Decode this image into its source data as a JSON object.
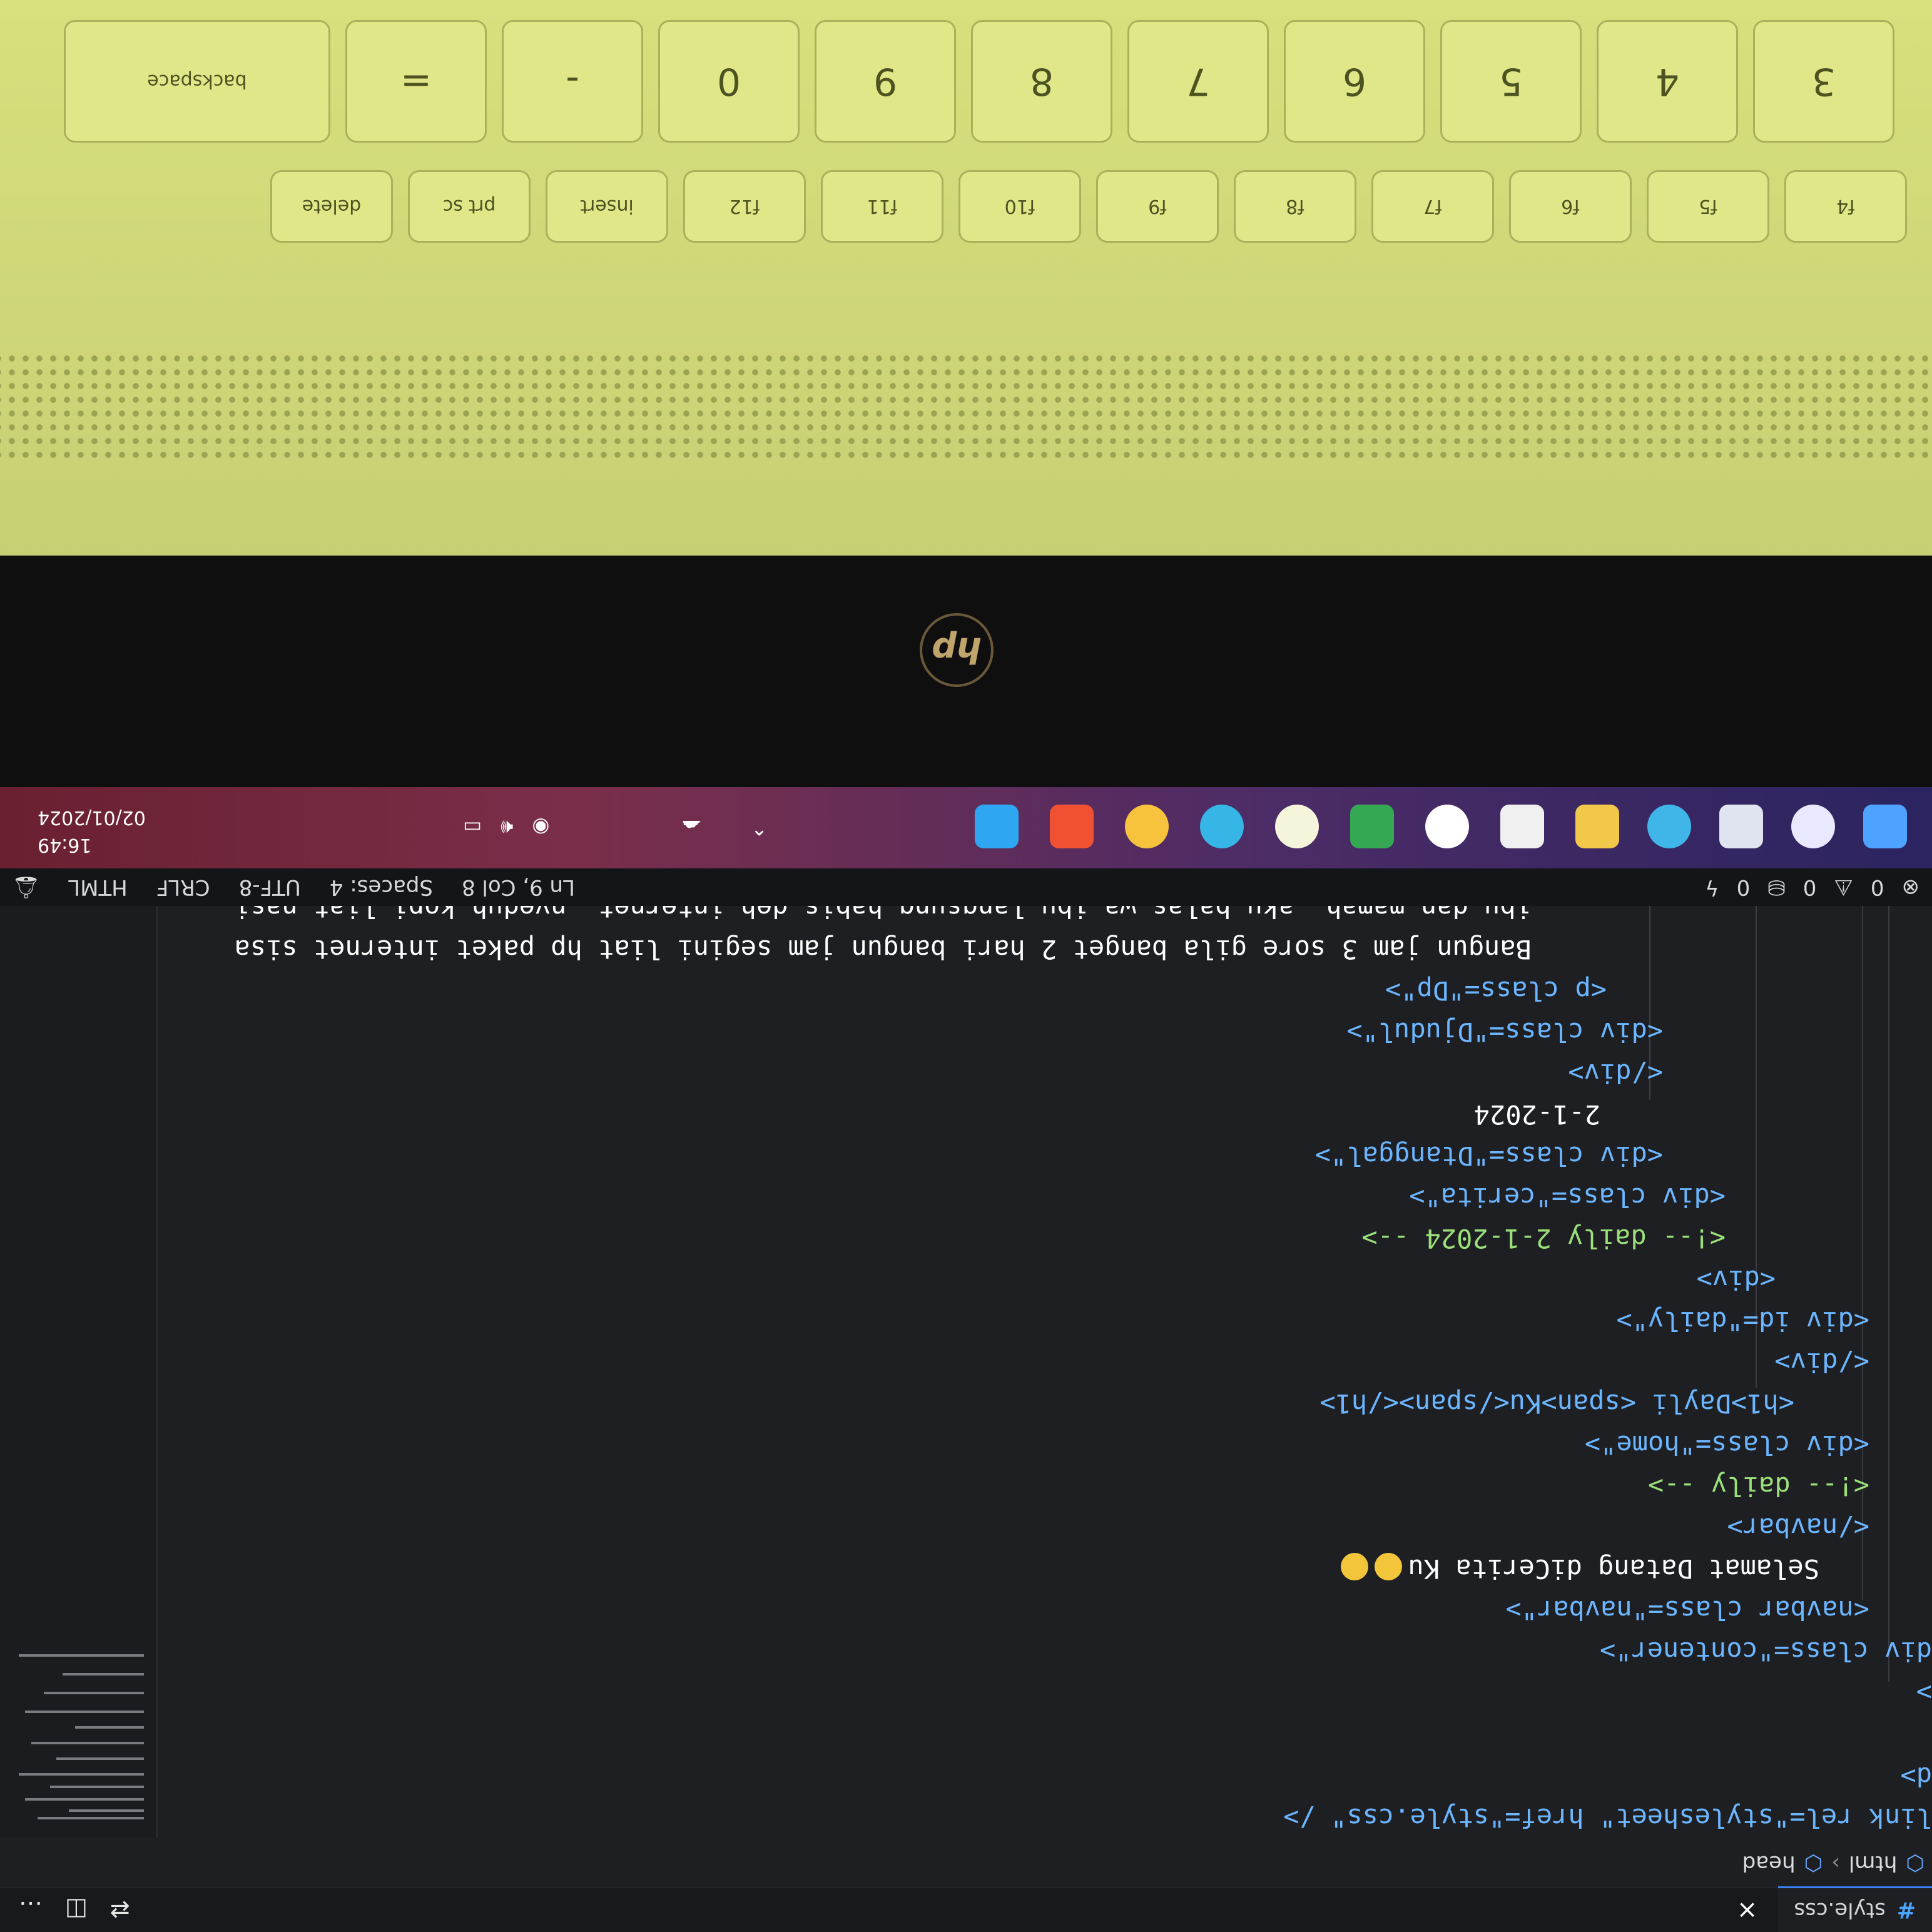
{
  "editor": {
    "tab": {
      "icon": "hash-icon",
      "title": "style.css",
      "close": "×"
    },
    "actions": [
      "⇄",
      "◫",
      "…"
    ],
    "breadcrumb": [
      "html",
      "head"
    ],
    "lines": {
      "l1": "link rel=\"stylesheet\" href=\"style.css\" />",
      "l2": "d>",
      "l3": ">",
      "l4": "div class=\"contener\">",
      "l5": "<navbar class=\"navbar\">",
      "l6": "Selamat Datang diCerita Ku",
      "l7": "</navbar>",
      "l8": "<!-- daily -->",
      "l9": "<div class=\"home\">",
      "l10a": "<h1>Dayli ",
      "l10b": "<span>Ku</span></h1>",
      "l11": "</div>",
      "l12": "<div id=\"daily\">",
      "l13": "<div>",
      "l14": "<!-- daily 2-1-2024 -->",
      "l15": "<div class=\"cerita\">",
      "l16": "<div class=\"Dtanggal\">",
      "l17": "2-1-2024",
      "l18": "</div>",
      "l19": "<div class=\"Djudul\">",
      "l20": "<p class=\"Dp\">",
      "l21": "Bangun jam 3 sore gila banget 2 hari bangun jam segini liat hp paket internet sisa",
      "l22": "ibu dan mamah ,aku balas wa ibu langsung habis deh internet ,nyeduh kopi liat nasi"
    }
  },
  "statusbar": {
    "errors": "0",
    "warnings": "0",
    "ports": "0",
    "position": "Ln 9, Col 8",
    "spaces": "Spaces: 4",
    "encoding": "UTF-8",
    "eol": "CRLF",
    "language": "HTML"
  },
  "taskbar": {
    "time": "16:49",
    "date": "02/01/2024",
    "icons": [
      "windows-start-icon",
      "search-icon",
      "task-view-icon",
      "edge-icon",
      "file-explorer-icon",
      "store-icon",
      "chrome-icon",
      "drive-icon",
      "search-app-icon",
      "app-icon",
      "chrome-canary-icon",
      "git-icon",
      "vscode-icon"
    ],
    "colors": {
      "accent": "#3b82f6",
      "tag": "#6cb6ff",
      "comment": "#9be07a"
    }
  },
  "keyboard": {
    "number_row": [
      "#",
      "$",
      "%",
      "^",
      "&",
      "*",
      "(",
      ")",
      "-",
      "="
    ],
    "number_keys": [
      "3",
      "4",
      "5",
      "6",
      "7",
      "8",
      "9",
      "0"
    ],
    "backspace": "backspace",
    "fn_row": [
      "f4",
      "f5",
      "f6",
      "f7",
      "f8",
      "f9",
      "f10",
      "f11",
      "f12",
      "insert",
      "prt sc",
      "delete"
    ],
    "logo": "hp"
  }
}
